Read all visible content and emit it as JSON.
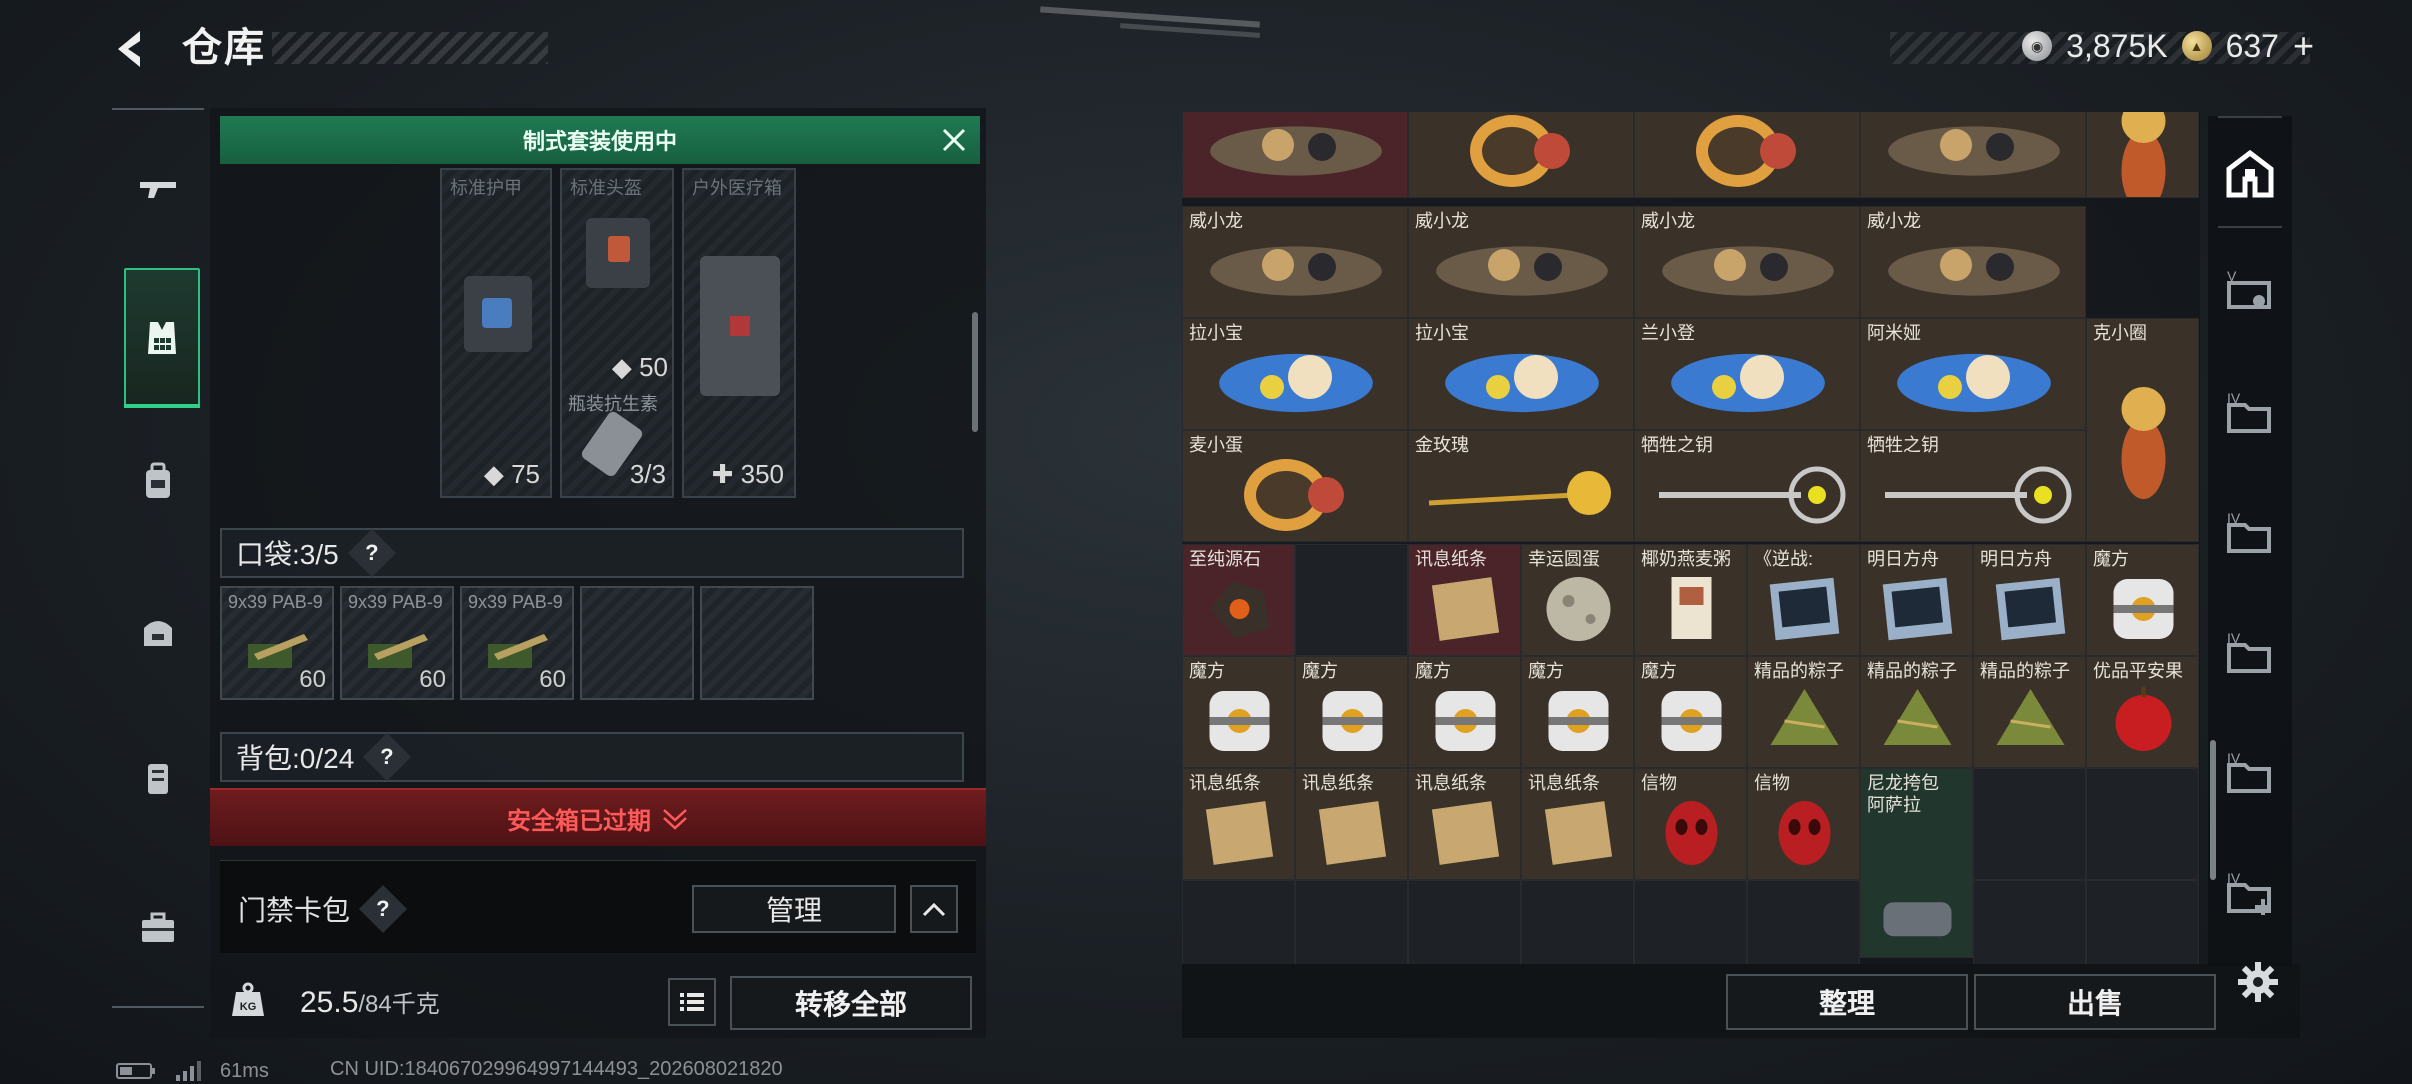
{
  "header": {
    "title": "仓库",
    "currency": [
      {
        "icon": "silver-coin-icon",
        "value": "3,875K"
      },
      {
        "icon": "gold-coin-icon",
        "value": "637",
        "suffix": "+"
      }
    ]
  },
  "left_nav": {
    "items": [
      {
        "name": "weapon",
        "icon": "gun-icon"
      },
      {
        "name": "gear",
        "icon": "vest-icon",
        "active": true
      },
      {
        "name": "backpack",
        "icon": "backpack-icon"
      },
      {
        "name": "bag",
        "icon": "bag-icon"
      },
      {
        "name": "case",
        "icon": "case-icon"
      },
      {
        "name": "toolbox",
        "icon": "toolbox-icon"
      }
    ]
  },
  "loadout": {
    "banner": "制式套装使用中",
    "slots": [
      {
        "label": "标准护甲",
        "value": "75",
        "icon": "shield-icon"
      },
      {
        "label": "标准头盔",
        "value": "50",
        "icon": "shield-icon",
        "sub_label": "瓶装抗生素",
        "sub_value": "3/3"
      },
      {
        "label": "户外医疗箱",
        "value": "350",
        "icon": "plus-icon"
      }
    ],
    "pocket": {
      "label": "口袋:",
      "value": "3/5",
      "items": [
        {
          "label": "9x39 PAB-9",
          "count": "60"
        },
        {
          "label": "9x39 PAB-9",
          "count": "60"
        },
        {
          "label": "9x39 PAB-9",
          "count": "60"
        }
      ]
    },
    "backpack": {
      "label": "背包:",
      "value": "0/24"
    },
    "safe_box": "安全箱已过期",
    "access_card": {
      "label": "门禁卡包",
      "manage": "管理"
    },
    "weight": {
      "value": "25.5",
      "max": "/84千克",
      "icon_text": "KG"
    },
    "transfer_all": "转移全部"
  },
  "storage": {
    "rows": [
      [
        {
          "name": "",
          "art": "doll-dark",
          "bg": "red"
        },
        {
          "name": "",
          "art": "egg-doll",
          "bg": "brown"
        },
        {
          "name": "",
          "art": "egg-doll",
          "bg": "brown"
        },
        {
          "name": "",
          "art": "hood-doll",
          "bg": "brown"
        },
        {
          "name": "",
          "art": "hood-tall",
          "bg": "brown"
        }
      ],
      [
        {
          "name": "威小龙",
          "art": "dragon",
          "bg": "brown"
        },
        {
          "name": "威小龙",
          "art": "dragon",
          "bg": "brown"
        },
        {
          "name": "威小龙",
          "art": "dragon",
          "bg": "brown"
        },
        {
          "name": "威小龙",
          "art": "dragon",
          "bg": "brown"
        }
      ],
      [
        {
          "name": "拉小宝",
          "art": "blue-doll",
          "bg": "brown"
        },
        {
          "name": "拉小宝",
          "art": "blue-doll",
          "bg": "brown"
        },
        {
          "name": "兰小登",
          "art": "sombrero-doll",
          "bg": "brown"
        },
        {
          "name": "阿米娅",
          "art": "bunny-doll",
          "bg": "brown"
        },
        {
          "name": "克小圈",
          "art": "girl-tall",
          "bg": "brown"
        }
      ],
      [
        {
          "name": "麦小蛋",
          "art": "egg-bunny",
          "bg": "brown"
        },
        {
          "name": "金玫瑰",
          "art": "gold-rose",
          "bg": "brown"
        },
        {
          "name": "牺牲之钥",
          "art": "key",
          "bg": "brown"
        },
        {
          "name": "牺牲之钥",
          "art": "key",
          "bg": "brown"
        }
      ],
      [
        {
          "name": "至纯源石",
          "art": "ore",
          "bg": "red"
        },
        {
          "name": "",
          "art": "",
          "bg": "empty"
        },
        {
          "name": "讯息纸条",
          "art": "paper",
          "bg": "red"
        },
        {
          "name": "幸运圆蛋",
          "art": "moon-egg",
          "bg": "brown"
        },
        {
          "name": "椰奶燕麦粥",
          "art": "book",
          "bg": "brown"
        },
        {
          "name": "《逆战:",
          "art": "card-box",
          "bg": "brown"
        },
        {
          "name": "明日方舟",
          "art": "ticket",
          "bg": "brown"
        },
        {
          "name": "明日方舟",
          "art": "ticket",
          "bg": "brown"
        },
        {
          "name": "魔方",
          "art": "cube",
          "bg": "brown"
        }
      ],
      [
        {
          "name": "魔方",
          "art": "cube",
          "bg": "brown"
        },
        {
          "name": "魔方",
          "art": "cube",
          "bg": "brown"
        },
        {
          "name": "魔方",
          "art": "cube",
          "bg": "brown"
        },
        {
          "name": "魔方",
          "art": "cube",
          "bg": "brown"
        },
        {
          "name": "魔方",
          "art": "cube",
          "bg": "brown"
        },
        {
          "name": "精品的粽子",
          "art": "zongzi",
          "bg": "brown"
        },
        {
          "name": "精品的粽子",
          "art": "zongzi",
          "bg": "brown"
        },
        {
          "name": "精品的粽子",
          "art": "zongzi",
          "bg": "brown"
        },
        {
          "name": "优品平安果",
          "art": "apple",
          "bg": "brown"
        }
      ],
      [
        {
          "name": "讯息纸条",
          "art": "paper",
          "bg": "brown"
        },
        {
          "name": "讯息纸条",
          "art": "paper",
          "bg": "brown"
        },
        {
          "name": "讯息纸条",
          "art": "paper",
          "bg": "brown"
        },
        {
          "name": "讯息纸条",
          "art": "paper",
          "bg": "brown"
        },
        {
          "name": "信物",
          "art": "mask",
          "bg": "brown"
        },
        {
          "name": "信物",
          "art": "mask",
          "bg": "brown"
        },
        {
          "name": "尼龙挎包\n阿萨拉",
          "art": "duffel",
          "bg": "green"
        }
      ]
    ],
    "sort": "整理",
    "sell": "出售"
  },
  "right_tabs": [
    "home-icon",
    "tab-v-icon",
    "tab-iv-icon",
    "tab-iv-icon",
    "tab-iv-icon",
    "tab-iv-icon",
    "tab-iv-add-icon"
  ],
  "status": {
    "ping": "61ms",
    "uid": "CN UID:1840670299649971444​93_202608021820"
  }
}
